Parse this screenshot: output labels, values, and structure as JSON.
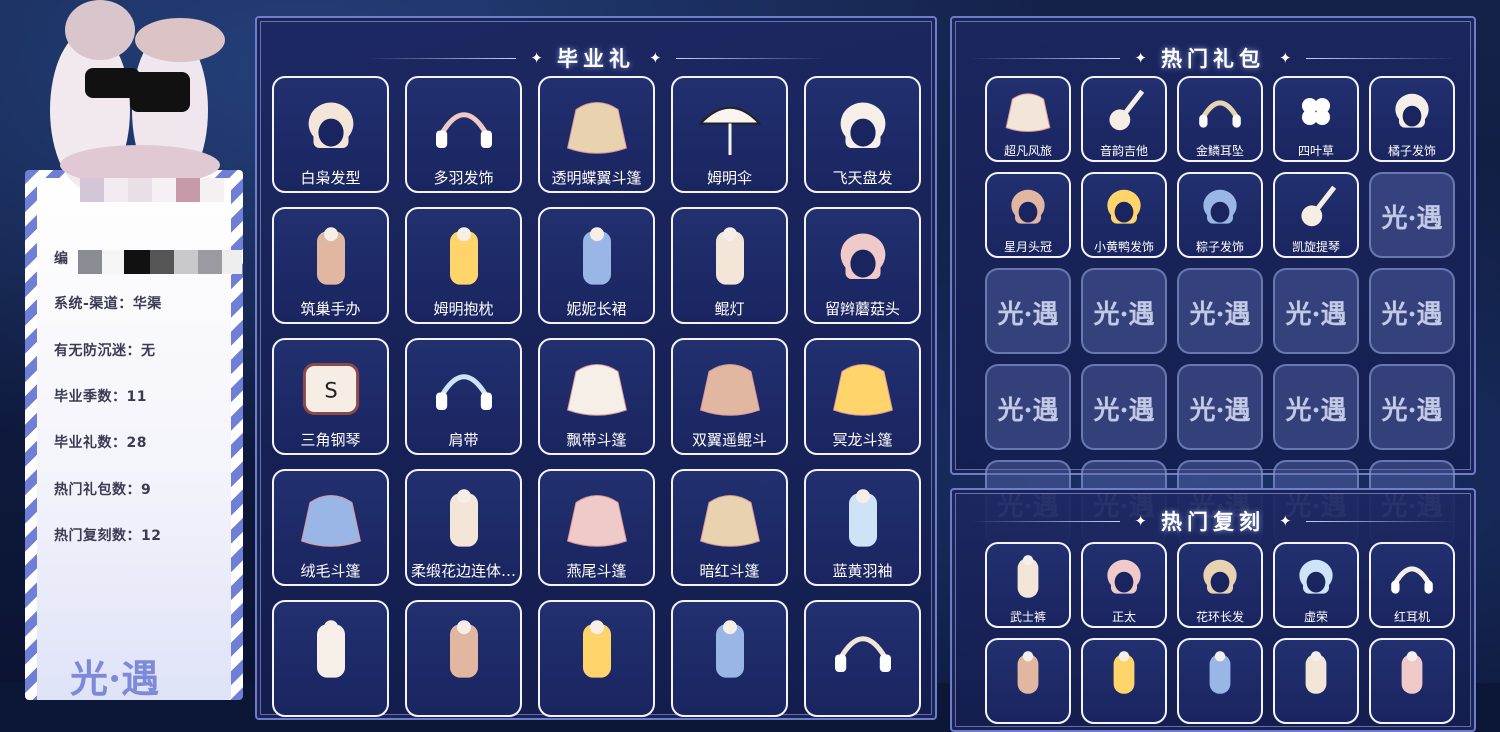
{
  "colors": {
    "panel_border": "#6e7ccf",
    "tile_border": "#f2f4ff",
    "panel_bg": "#1c2660"
  },
  "left_card": {
    "id_label": "编",
    "rows": [
      {
        "label": "系统-渠道：",
        "value": "华渠"
      },
      {
        "label": "有无防沉迷：",
        "value": "无"
      },
      {
        "label": "毕业季数：",
        "value": "11"
      },
      {
        "label": "毕业礼数：",
        "value": "28"
      },
      {
        "label": "热门礼包数：",
        "value": "9"
      },
      {
        "label": "热门复刻数：",
        "value": "12"
      }
    ],
    "logo": "光·遇"
  },
  "graduation": {
    "title": "毕业礼",
    "star": "✦",
    "items": [
      {
        "label": "白枭发型",
        "icon": "owl-hair-icon"
      },
      {
        "label": "多羽发饰",
        "icon": "feather-headband-icon"
      },
      {
        "label": "透明蝶翼斗篷",
        "icon": "butterfly-cape-icon"
      },
      {
        "label": "姆明伞",
        "icon": "umbrella-icon"
      },
      {
        "label": "飞天盘发",
        "icon": "bun-hair-icon"
      },
      {
        "label": "筑巢手办",
        "icon": "figurine-icon"
      },
      {
        "label": "姆明抱枕",
        "icon": "moomin-pillow-icon"
      },
      {
        "label": "妮妮长裙",
        "icon": "dress-icon"
      },
      {
        "label": "鲲灯",
        "icon": "lantern-icon"
      },
      {
        "label": "留辫蘑菇头",
        "icon": "bob-hair-icon"
      },
      {
        "label": "三角钢琴",
        "icon": "piano-icon"
      },
      {
        "label": "肩带",
        "icon": "shoulder-strap-icon"
      },
      {
        "label": "飘带斗篷",
        "icon": "ribbon-cape-icon"
      },
      {
        "label": "双翼遥鲲斗",
        "icon": "wing-cape-icon"
      },
      {
        "label": "冥龙斗篷",
        "icon": "dragon-cape-icon"
      },
      {
        "label": "绒毛斗篷",
        "icon": "fur-cape-icon"
      },
      {
        "label": "柔缎花边连体…",
        "icon": "jumpsuit-icon"
      },
      {
        "label": "燕尾斗篷",
        "icon": "swallowtail-cape-icon"
      },
      {
        "label": "暗红斗篷",
        "icon": "red-cape-icon"
      },
      {
        "label": "蓝黄羽袖",
        "icon": "feather-sleeve-icon"
      },
      {
        "label": "",
        "icon": "outfit-icon"
      },
      {
        "label": "",
        "icon": "blue-hood-icon"
      },
      {
        "label": "",
        "icon": "robe-icon"
      },
      {
        "label": "",
        "icon": "card-icon"
      },
      {
        "label": "",
        "icon": "necklace-icon"
      }
    ]
  },
  "hot_packs": {
    "title": "热门礼包",
    "star": "✦",
    "items": [
      {
        "label": "超凡风旅",
        "icon": "cape-pack-icon"
      },
      {
        "label": "音韵吉他",
        "icon": "guitar-icon"
      },
      {
        "label": "金鳞耳坠",
        "icon": "earring-icon"
      },
      {
        "label": "四叶草",
        "icon": "clover-icon"
      },
      {
        "label": "橘子发饰",
        "icon": "orange-hairpin-icon"
      },
      {
        "label": "星月头冠",
        "icon": "star-moon-crown-icon"
      },
      {
        "label": "小黄鸭发饰",
        "icon": "duck-hairpin-icon"
      },
      {
        "label": "粽子发饰",
        "icon": "zongzi-hairpin-icon"
      },
      {
        "label": "凯旋提琴",
        "icon": "violin-icon"
      }
    ],
    "placeholder_mark": "光·遇",
    "placeholder_count": 16
  },
  "hot_reruns": {
    "title": "热门复刻",
    "star": "✦",
    "items": [
      {
        "label": "武士裤",
        "icon": "samurai-pants-icon"
      },
      {
        "label": "正太",
        "icon": "short-hair-icon"
      },
      {
        "label": "花环长发",
        "icon": "flower-crown-hair-icon"
      },
      {
        "label": "虚荣",
        "icon": "vanity-hair-icon"
      },
      {
        "label": "红耳机",
        "icon": "headphones-icon"
      },
      {
        "label": "",
        "icon": "straw-hat-icon"
      },
      {
        "label": "",
        "icon": "lamp-hat-icon"
      },
      {
        "label": "",
        "icon": "shawl-icon"
      },
      {
        "label": "",
        "icon": "mask-icon"
      },
      {
        "label": "",
        "icon": "pants-icon"
      }
    ]
  }
}
